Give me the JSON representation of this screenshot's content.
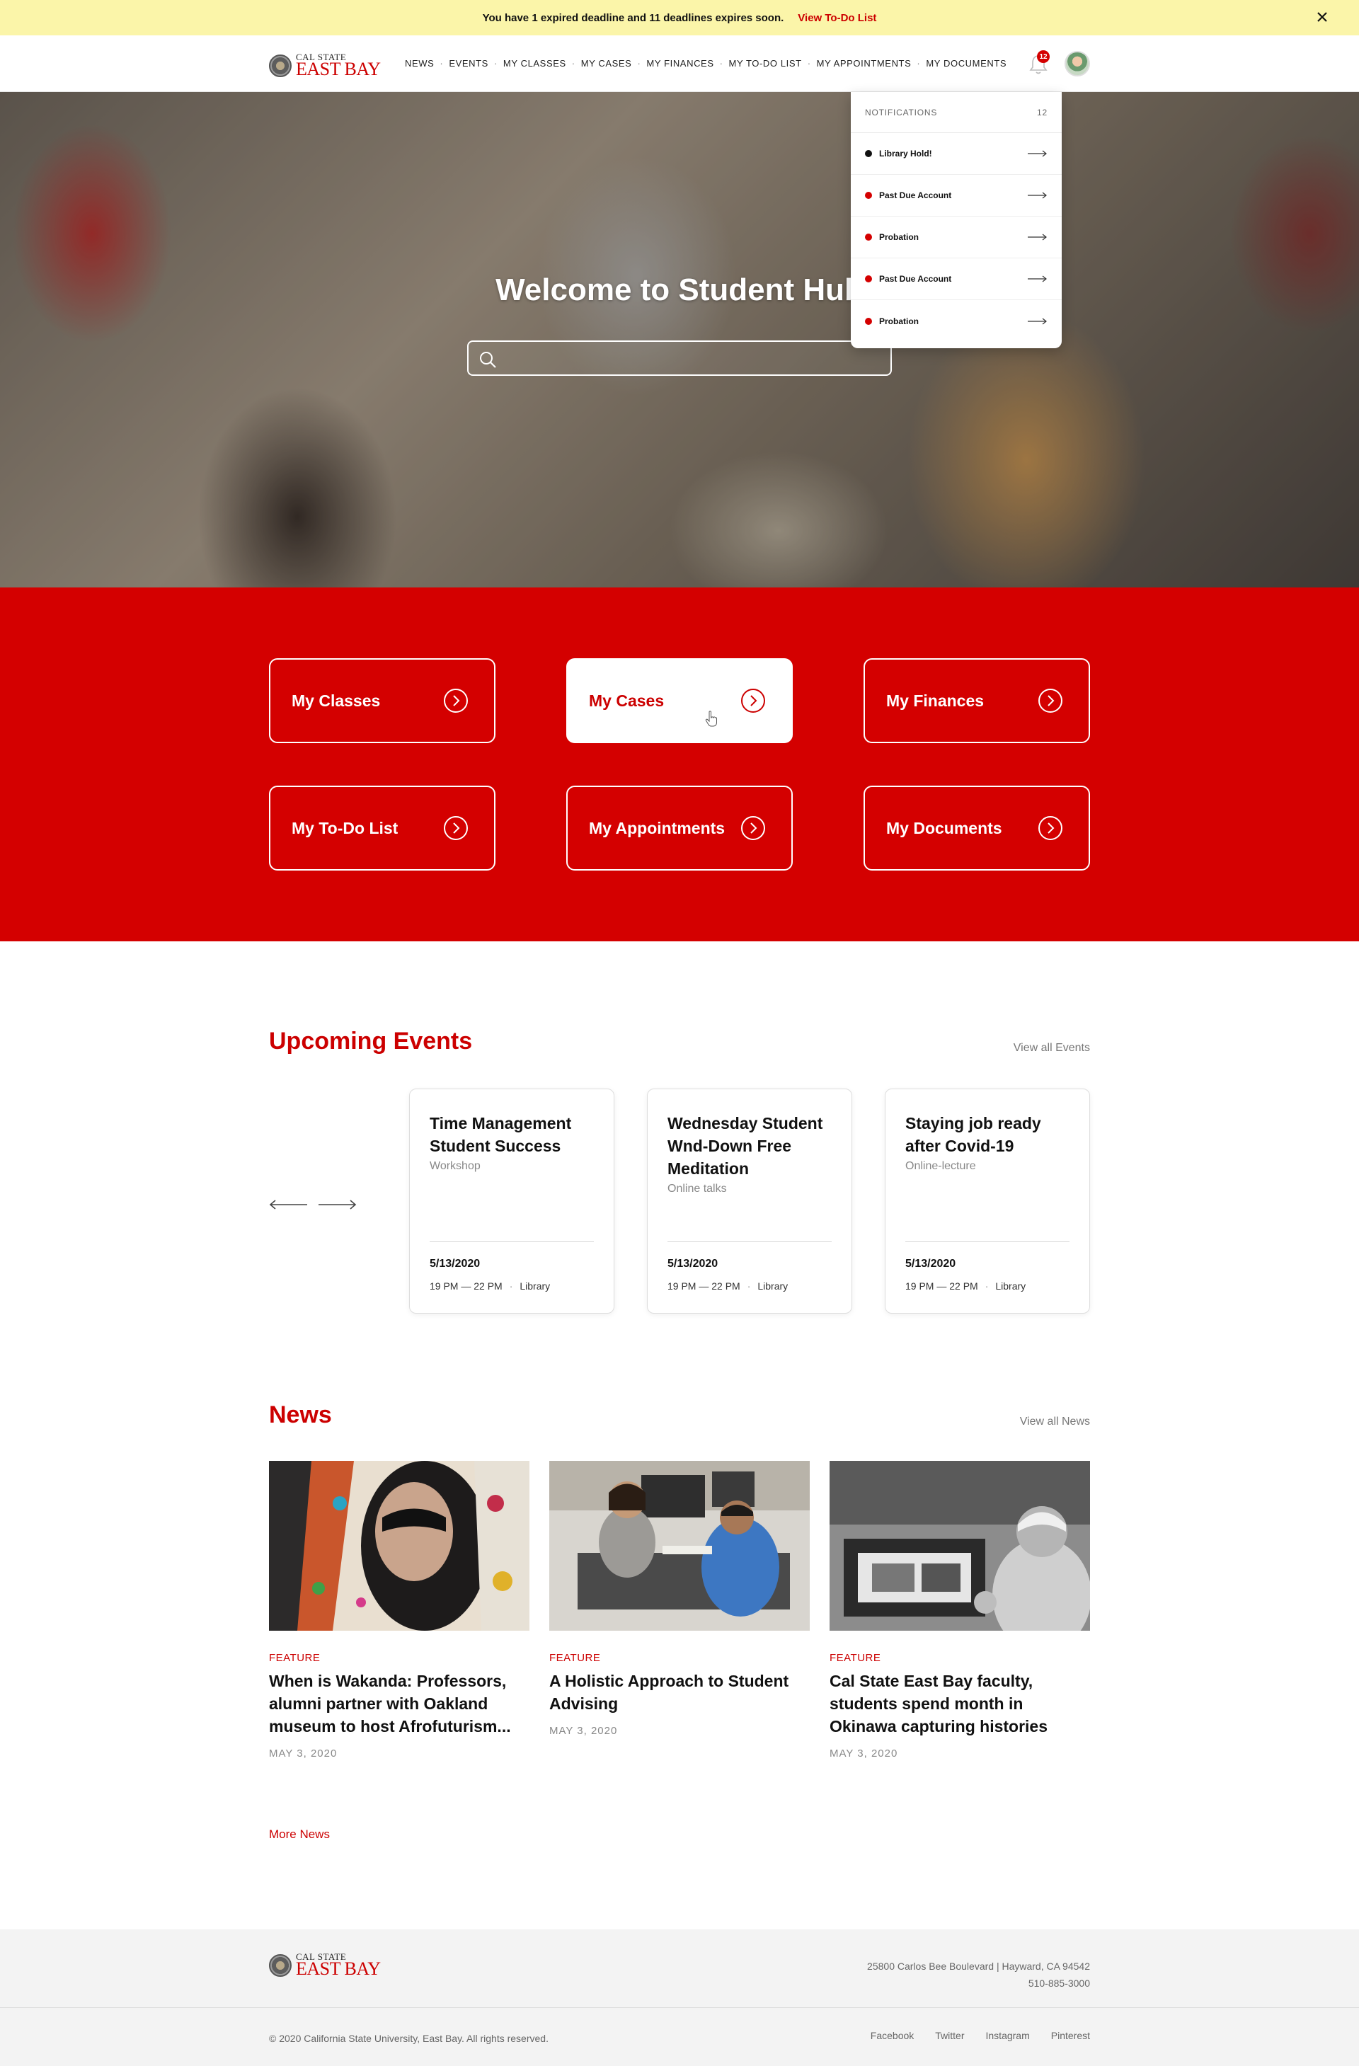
{
  "alert": {
    "message": "You have 1 expired deadline and 11 deadlines expires soon.",
    "link": "View To-Do List"
  },
  "brand": {
    "line1": "CAL STATE",
    "line2": "EAST BAY"
  },
  "nav": {
    "items": [
      "NEWS",
      "EVENTS",
      "MY CLASSES",
      "MY CASES",
      "MY FINANCES",
      "MY TO-DO LIST",
      "MY APPOINTMENTS",
      "MY DOCUMENTS"
    ],
    "bell_count": "12"
  },
  "hero": {
    "title": "Welcome to Student Hub",
    "search_placeholder": ""
  },
  "notifications": {
    "heading": "NOTIFICATIONS",
    "count": "12",
    "items": [
      {
        "label": "Library Hold!",
        "color": "#111111"
      },
      {
        "label": "Past Due Account",
        "color": "#d40000"
      },
      {
        "label": "Probation",
        "color": "#d40000"
      },
      {
        "label": "Past Due Account",
        "color": "#d40000"
      },
      {
        "label": "Probation",
        "color": "#d40000"
      }
    ]
  },
  "quick_links": [
    "My Classes",
    "My Cases",
    "My Finances",
    "My To-Do List",
    "My Appointments",
    "My Documents"
  ],
  "events": {
    "title": "Upcoming Events",
    "view_all": "View all Events",
    "items": [
      {
        "title": "Time Management Student Success",
        "type": "Workshop",
        "date": "5/13/2020",
        "time": "19 PM — 22 PM",
        "location": "Library"
      },
      {
        "title": "Wednesday Student Wnd-Down Free Meditation",
        "type": "Online talks",
        "date": "5/13/2020",
        "time": "19 PM — 22 PM",
        "location": "Library"
      },
      {
        "title": "Staying job ready after Covid-19",
        "type": "Online-lecture",
        "date": "5/13/2020",
        "time": "19 PM — 22 PM",
        "location": "Library"
      }
    ]
  },
  "news": {
    "title": "News",
    "view_all": "View all News",
    "more": "More News",
    "items": [
      {
        "category": "FEATURE",
        "title": "When is Wakanda: Professors, alumni partner with Oakland museum to host Afrofuturism...",
        "date": "MAY 3, 2020"
      },
      {
        "category": "FEATURE",
        "title": "A Holistic Approach to Student Advising",
        "date": "MAY 3, 2020"
      },
      {
        "category": "FEATURE",
        "title": "Cal State East Bay faculty, students spend month in Okinawa capturing histories",
        "date": "MAY 3, 2020"
      }
    ]
  },
  "footer": {
    "address": "25800 Carlos Bee Boulevard | Hayward, CA 94542",
    "phone": "510-885-3000",
    "copyright": "© 2020 California State University, East Bay. All rights reserved.",
    "social": [
      "Facebook",
      "Twitter",
      "Instagram",
      "Pinterest"
    ]
  },
  "colors": {
    "brand_red": "#d40000",
    "alert_yellow": "#fbf5a9"
  }
}
